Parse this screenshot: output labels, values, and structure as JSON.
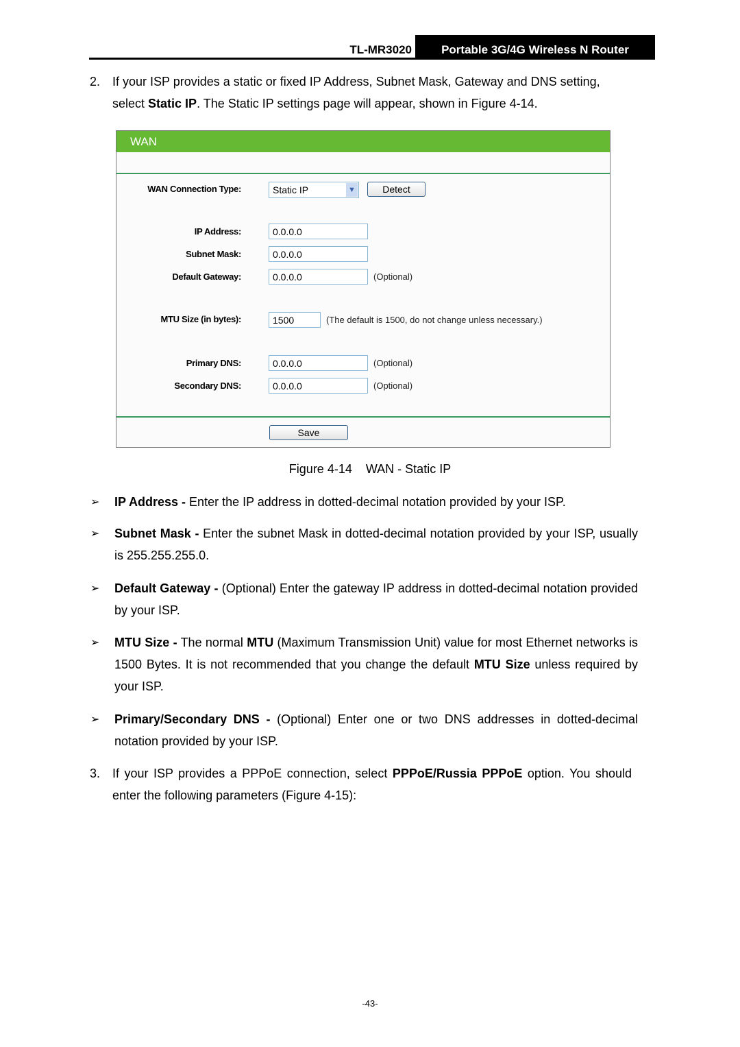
{
  "header": {
    "model": "TL-MR3020",
    "product": "Portable 3G/4G Wireless N Router"
  },
  "step2": {
    "number": "2.",
    "line1": "If your ISP provides a static or fixed IP Address, Subnet Mask, Gateway and DNS setting,",
    "line2_pre": "select ",
    "line2_bold": "Static IP",
    "line2_post": ". The Static IP settings page will appear, shown in Figure 4-14."
  },
  "figure": {
    "title": "WAN",
    "connection_type_label": "WAN Connection Type:",
    "connection_type_value": "Static IP",
    "detect_button": "Detect",
    "fields": [
      {
        "label": "IP Address:",
        "value": "0.0.0.0",
        "note": ""
      },
      {
        "label": "Subnet Mask:",
        "value": "0.0.0.0",
        "note": ""
      },
      {
        "label": "Default Gateway:",
        "value": "0.0.0.0",
        "note": "(Optional)"
      },
      {
        "label": "MTU Size (in bytes):",
        "value": "1500",
        "note": "(The default is 1500, do not change unless necessary.)"
      },
      {
        "label": "Primary DNS:",
        "value": "0.0.0.0",
        "note": "(Optional)"
      },
      {
        "label": "Secondary DNS:",
        "value": "0.0.0.0",
        "note": "(Optional)"
      }
    ],
    "save_button": "Save",
    "caption": "Figure 4-14    WAN - Static IP"
  },
  "bullets": [
    {
      "bold": "IP Address -",
      "text": " Enter the IP address in dotted-decimal notation provided by your ISP."
    },
    {
      "bold": "Subnet Mask -",
      "text": " Enter the subnet Mask in dotted-decimal notation provided by your ISP, usually is 255.255.255.0."
    },
    {
      "bold": "Default Gateway -",
      "text": " (Optional) Enter the gateway IP address in dotted-decimal notation provided by your ISP."
    },
    {
      "bold": "MTU Size -",
      "text1": " The normal ",
      "bold2": "MTU",
      "text2": " (Maximum Transmission Unit) value for most Ethernet networks is 1500 Bytes. It is not recommended that you change the default ",
      "bold3": "MTU Size",
      "text3": " unless required by your ISP."
    },
    {
      "bold": "Primary/Secondary DNS -",
      "text": " (Optional) Enter one or two DNS addresses in dotted-decimal notation provided by your ISP."
    }
  ],
  "step3": {
    "number": "3.",
    "pre": "If your ISP provides a PPPoE connection, select ",
    "bold": "PPPoE/Russia PPPoE",
    "post": " option. You should enter the following parameters (Figure 4-15):"
  },
  "bullet_glyph": "➢",
  "page_number": "-43-"
}
